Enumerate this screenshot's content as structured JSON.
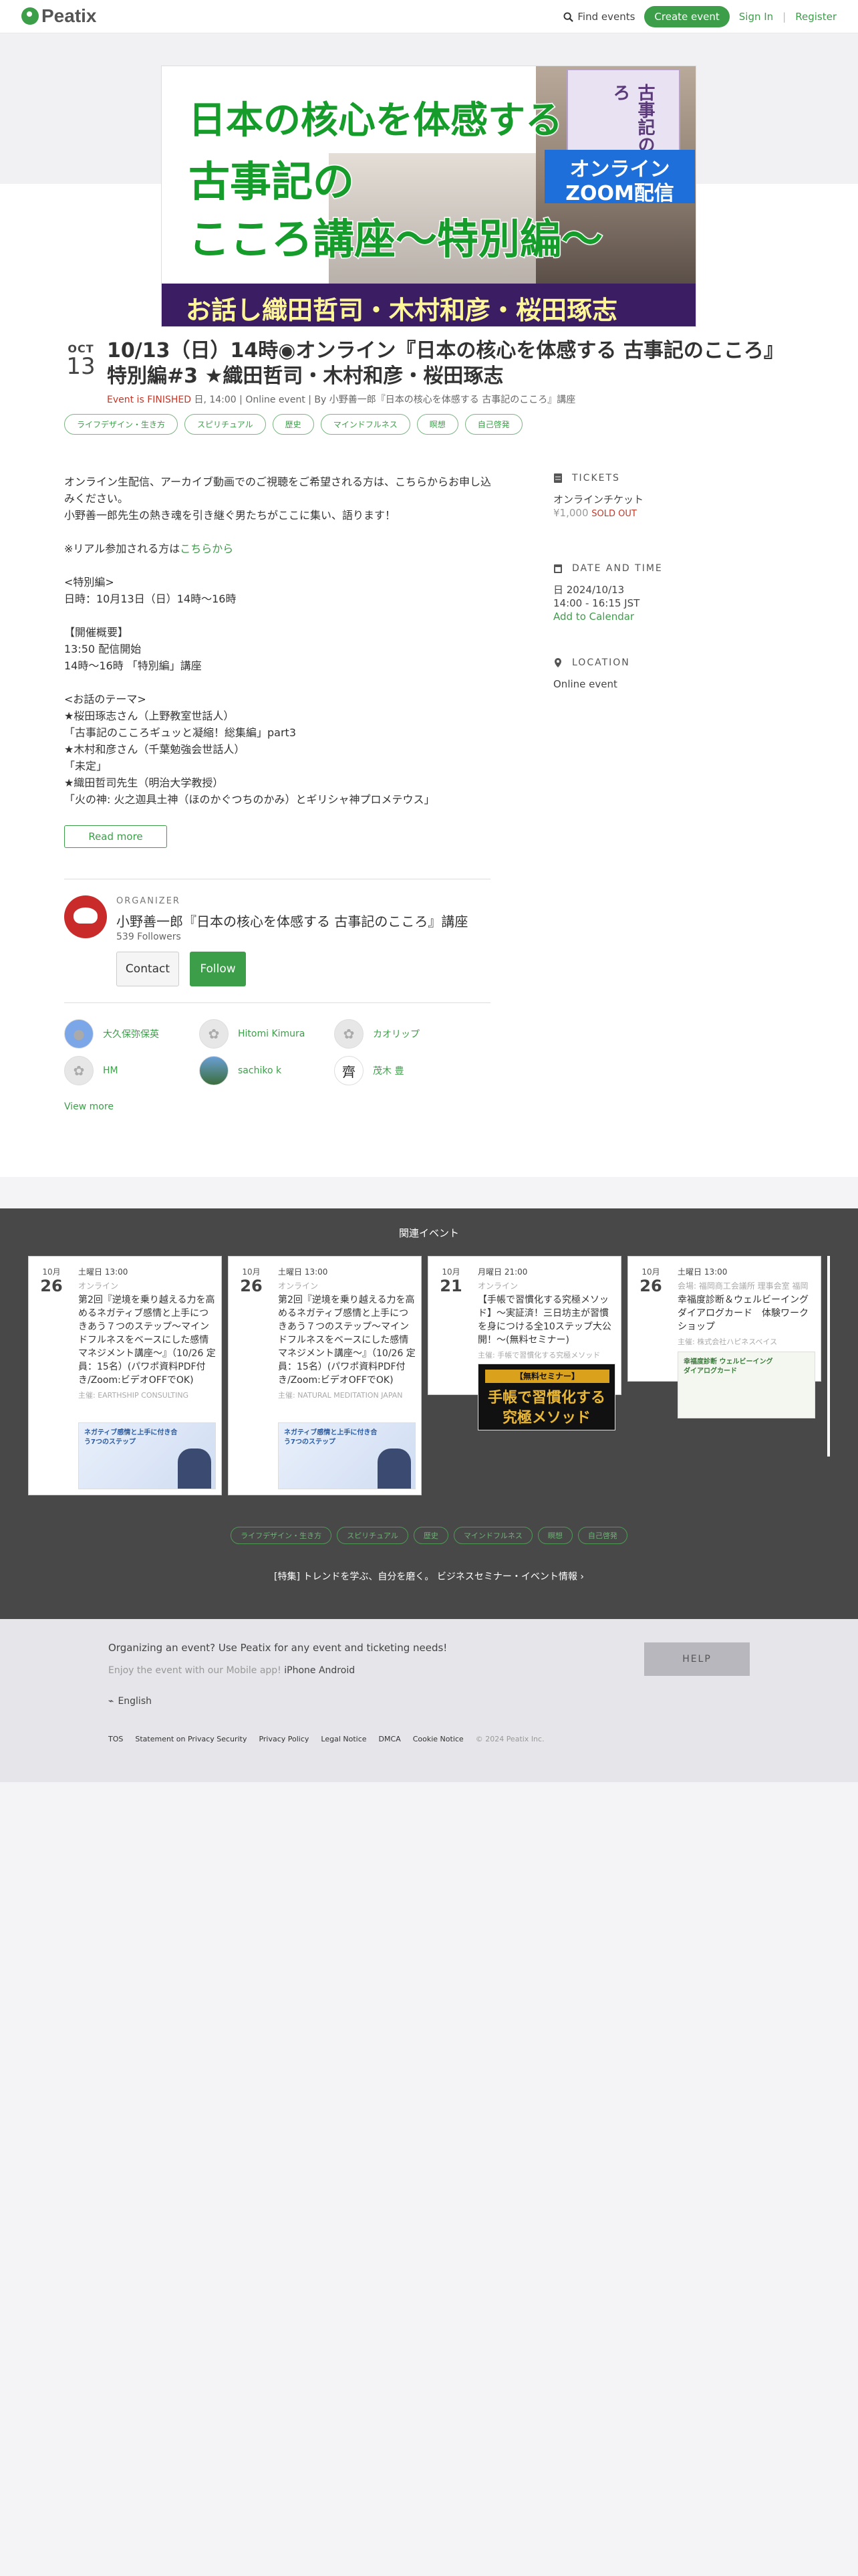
{
  "header": {
    "logo": "Peatix",
    "find_events": "Find events",
    "create_event": "Create event",
    "sign_in": "Sign In",
    "separator": "|",
    "register": "Register"
  },
  "banner": {
    "line1": "日本の核心を体感する",
    "line2": "古事記の",
    "line3": "こころ講座〜特別編〜",
    "badge1": "オンライン",
    "badge2": "ZOOM配信",
    "book_title": "古事記のこころ",
    "speakers": "お話し織田哲司・木村和彦・桜田琢志"
  },
  "event": {
    "month": "OCT",
    "day": "13",
    "title": "10/13（日）14時◉オンライン『日本の核心を体感する 古事記のこころ』特別編#3 ★織田哲司・木村和彦・桜田琢志",
    "finished": "Event is FINISHED",
    "meta": " 日, 14:00 | Online event | By 小野善一郎『日本の核心を体感する 古事記のこころ』講座",
    "tags": [
      "ライフデザイン・生き方",
      "スピリチュアル",
      "歴史",
      "マインドフルネス",
      "瞑想",
      "自己啓発"
    ]
  },
  "description": {
    "p1": "オンライン生配信、アーカイブ動画でのご視聴をご希望される方は、こちらからお申し込みください。\n小野善一郎先生の熱き魂を引き継ぐ男たちがここに集い、語ります！\n\n",
    "p2a": "※リアル参加される方は",
    "p2link": "こちらから",
    "p3": "\n\n<特別編>\n日時：10月13日（日）14時〜16時\n\n【開催概要】\n13:50 配信開始\n14時〜16時 「特別編」講座\n\n<お話のテーマ>\n★桜田琢志さん（上野教室世話人）\n「古事記のこころギュッと凝縮！総集編」part3\n★木村和彦さん（千葉勉強会世話人）\n「未定」\n★織田哲司先生（明治大学教授）\n「火の神: 火之迦具土神（ほのかぐつちのかみ）とギリシャ神プロメテウス」",
    "read_more": "Read more"
  },
  "organizer": {
    "label": "ORGANIZER",
    "name": "小野善一郎『日本の核心を体感する 古事記のこころ』講座",
    "followers": "539 Followers",
    "contact": "Contact",
    "follow": "Follow"
  },
  "attendees": [
    {
      "name": "大久保弥保英"
    },
    {
      "name": "Hitomi Kimura"
    },
    {
      "name": "カオリップ"
    },
    {
      "name": "HM"
    },
    {
      "name": "sachiko k"
    },
    {
      "name": "茂木 豊"
    }
  ],
  "view_more": "View more",
  "sidebar": {
    "tickets_h": "TICKETS",
    "ticket_name": "オンラインチケット",
    "ticket_price": "¥1,000",
    "sold_out": "SOLD OUT",
    "date_h": "DATE AND TIME",
    "date_line": "日 2024/10/13",
    "time_line": "14:00 - 16:15 JST",
    "add_cal": "Add to Calendar",
    "location_h": "LOCATION",
    "location": "Online event"
  },
  "related": {
    "heading": "関連イベント",
    "cards": [
      {
        "month": "10月",
        "day": "26",
        "time": "土曜日 13:00",
        "kind": "オンライン",
        "title": "第2回『逆境を乗り越える力を高めるネガティブ感情と上手につきあう７つのステップ〜マインドフルネスをベースにした感情マネジメント講座〜』（10/26 定員：15名）(パワポ資料PDF付き/Zoom:ビデオOFFでOK)",
        "org": "主催: EARTHSHIP CONSULTING"
      },
      {
        "month": "10月",
        "day": "26",
        "time": "土曜日 13:00",
        "kind": "オンライン",
        "title": "第2回『逆境を乗り越える力を高めるネガティブ感情と上手につきあう７つのステップ〜マインドフルネスをベースにした感情マネジメント講座〜』（10/26 定員：15名）(パワポ資料PDF付き/Zoom:ビデオOFFでOK)",
        "org": "主催: NATURAL MEDITATION JAPAN"
      },
      {
        "month": "10月",
        "day": "21",
        "time": "月曜日 21:00",
        "kind": "オンライン",
        "title": "【手帳で習慣化する究極メソッド】〜実証済！三日坊主が習慣を身につける全10ステップ大公開！〜(無料セミナー)",
        "org": "主催: 手帳で習慣化する究極メソッド"
      },
      {
        "month": "10月",
        "day": "26",
        "time": "土曜日 13:00",
        "kind": "会場: 福岡商工会議所 理事会室 福岡",
        "title": "幸福度診断＆ウェルビーイングダイアログカード　体験ワークショップ",
        "org": "主催: 株式会社ハピネスベイス"
      }
    ],
    "card_img_text": "ネガティブ感情と上手に付き合う7つのステップ",
    "dark_band": "【無料セミナー】",
    "dark_t1": "手帳で習慣化する",
    "dark_t2": "究極メソッド",
    "c4_img": "幸福度診断 ウェルビーイングダイアログカード",
    "tags": [
      "ライフデザイン・生き方",
      "スピリチュアル",
      "歴史",
      "マインドフルネス",
      "瞑想",
      "自己啓発"
    ],
    "feature_link": "[特集] トレンドを学ぶ、自分を磨く。 ビジネスセミナー・イベント情報"
  },
  "footer": {
    "organizing": "Organizing an event? Use Peatix for any event and ticketing needs!",
    "mobile": "Enjoy the event with our Mobile app!",
    "iphone": "iPhone",
    "android": "Android",
    "lang": "English",
    "help": "HELP",
    "links": [
      "TOS",
      "Statement on Privacy Security",
      "Privacy Policy",
      "Legal Notice",
      "DMCA",
      "Cookie Notice"
    ],
    "copyright": "© 2024 Peatix Inc."
  },
  "colors": {
    "brand": "#3d9e4a",
    "related_bg": "#484848",
    "sold_out": "#c0392b"
  }
}
